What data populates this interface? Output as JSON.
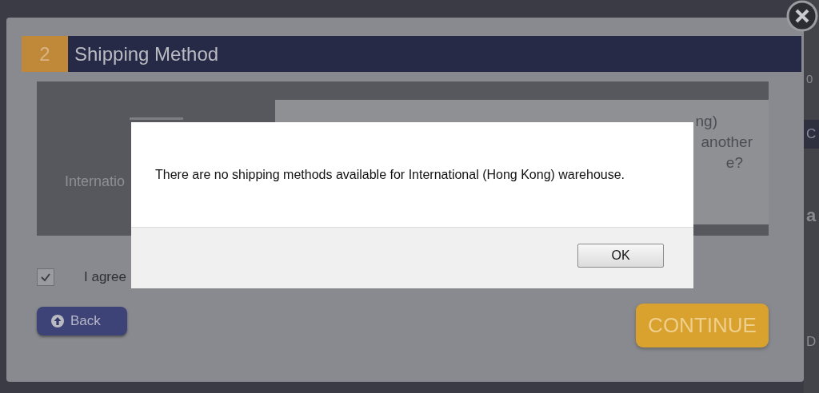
{
  "page_fragments": [
    "0",
    "C",
    "a",
    "D"
  ],
  "panel": {
    "step": "2",
    "title": "Shipping Method",
    "warehouse_label": "Internatio",
    "notice_lines": [
      "ng)",
      "another",
      "e?"
    ],
    "agree": {
      "label": "I agree",
      "checked": true
    },
    "back_button": "Back",
    "continue_button": "CONTINUE"
  },
  "dialog": {
    "message": "There are no shipping methods available for International (Hong Kong) warehouse.",
    "ok_button": "OK"
  }
}
